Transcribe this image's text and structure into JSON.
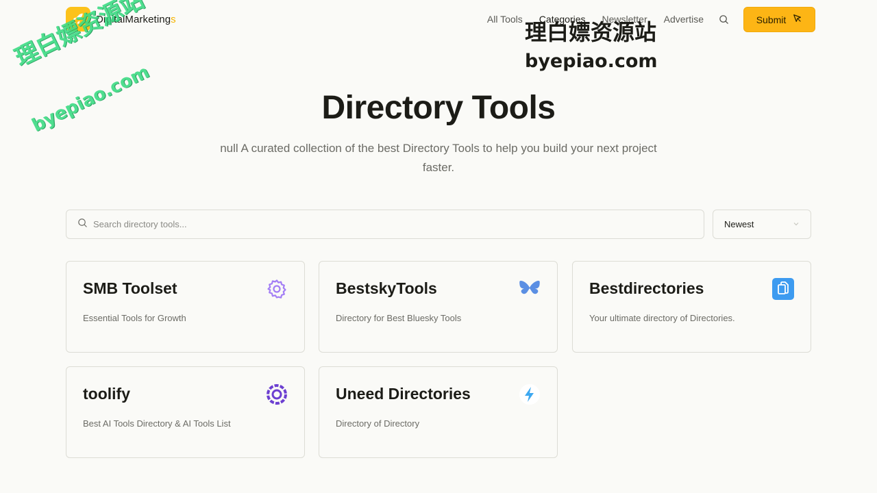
{
  "header": {
    "logo_text": "DigitalMarketing",
    "logo_accent": "s",
    "nav": [
      "All Tools",
      "Categories",
      "Newsletter",
      "Advertise"
    ],
    "submit_label": "Submit"
  },
  "hero": {
    "title": "Directory Tools",
    "subtitle": "null A curated collection of the best Directory Tools to help you build your next project faster."
  },
  "search": {
    "placeholder": "Search directory tools...",
    "sort_value": "Newest"
  },
  "cards": [
    {
      "title": "SMB Toolset",
      "description": "Essential Tools for Growth",
      "icon": "gear-icon"
    },
    {
      "title": "BestskyTools",
      "description": "Directory for Best Bluesky Tools",
      "icon": "butterfly-icon"
    },
    {
      "title": "Bestdirectories",
      "description": "Your ultimate directory of Directories.",
      "icon": "copy-icon"
    },
    {
      "title": "toolify",
      "description": "Best AI Tools Directory & AI Tools List",
      "icon": "toolify-logo-icon"
    },
    {
      "title": "Uneed Directories",
      "description": "Directory of Directory",
      "icon": "lightning-icon"
    }
  ],
  "watermark": {
    "cn": "理白嫖资源站",
    "url": "byepiao.com"
  },
  "colors": {
    "accent": "#fdb515",
    "background": "#fafaf7",
    "watermark_green": "#3ddc84"
  }
}
